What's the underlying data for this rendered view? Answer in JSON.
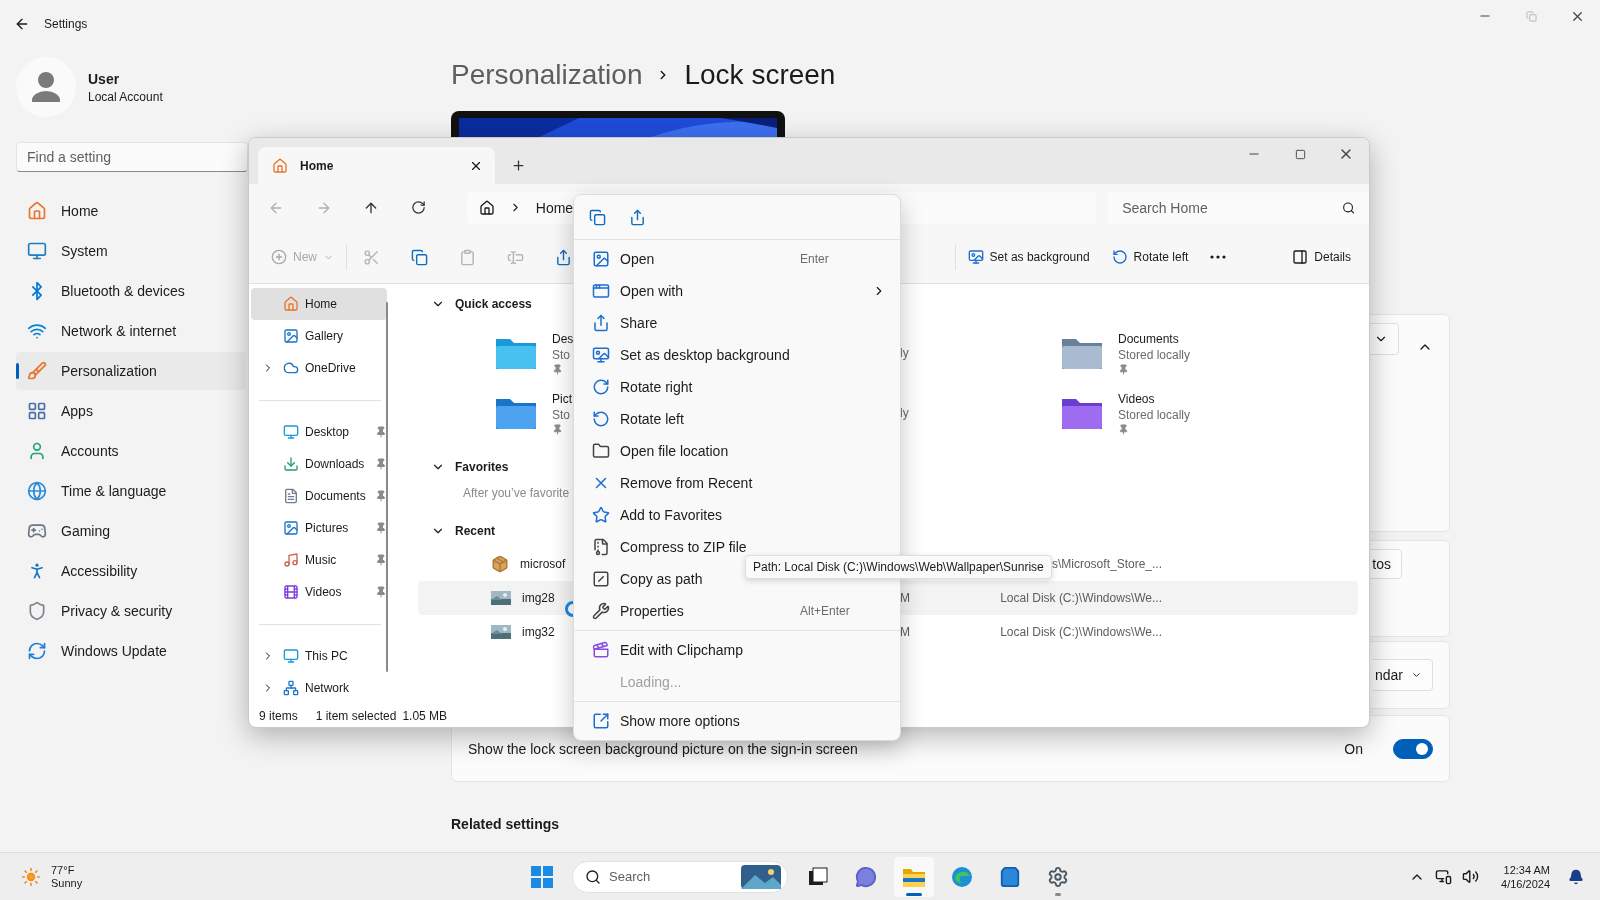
{
  "settings": {
    "title": "Settings",
    "user": {
      "name": "User",
      "account": "Local Account"
    },
    "search": {
      "placeholder": "Find a setting"
    },
    "nav": [
      {
        "label": "Home",
        "selected": false
      },
      {
        "label": "System",
        "selected": false
      },
      {
        "label": "Bluetooth & devices",
        "selected": false
      },
      {
        "label": "Network & internet",
        "selected": false
      },
      {
        "label": "Personalization",
        "selected": true
      },
      {
        "label": "Apps",
        "selected": false
      },
      {
        "label": "Accounts",
        "selected": false
      },
      {
        "label": "Time & language",
        "selected": false
      },
      {
        "label": "Gaming",
        "selected": false
      },
      {
        "label": "Accessibility",
        "selected": false
      },
      {
        "label": "Privacy & security",
        "selected": false
      },
      {
        "label": "Windows Update",
        "selected": false
      }
    ],
    "breadcrumb": {
      "parent": "Personalization",
      "current": "Lock screen"
    },
    "expand_card": {
      "expanded": true
    },
    "card_button": {
      "label": "tos"
    },
    "dropdown": {
      "value": "ndar"
    },
    "sign_in_setting": {
      "label": "Show the lock screen background picture on the sign-in screen",
      "state_text": "On",
      "on": true
    },
    "related_settings": {
      "title": "Related settings"
    }
  },
  "explorer": {
    "tab": {
      "title": "Home"
    },
    "address": {
      "location": "Home"
    },
    "search": {
      "placeholder": "Search Home"
    },
    "new_button": {
      "label": "New",
      "disabled": true
    },
    "command_icons": [
      {
        "disabled": true
      },
      {
        "disabled": false
      },
      {
        "disabled": true
      },
      {
        "disabled": true
      },
      {
        "disabled": false
      }
    ],
    "commands": [
      {
        "label": "Set as background"
      },
      {
        "label": "Rotate left"
      }
    ],
    "details_button": {
      "label": "Details"
    },
    "nav_groups": [
      [
        {
          "label": "Home",
          "selected": true
        },
        {
          "label": "Gallery",
          "selected": false
        },
        {
          "label": "OneDrive",
          "selected": false,
          "expanded": false
        }
      ],
      [
        {
          "label": "Desktop",
          "selected": false,
          "pinned": true
        },
        {
          "label": "Downloads",
          "selected": false,
          "pinned": true
        },
        {
          "label": "Documents",
          "selected": false,
          "pinned": true
        },
        {
          "label": "Pictures",
          "selected": false,
          "pinned": true
        },
        {
          "label": "Music",
          "selected": false,
          "pinned": true
        },
        {
          "label": "Videos",
          "selected": false,
          "pinned": true
        }
      ],
      [
        {
          "label": "This PC",
          "selected": false,
          "expanded": false
        },
        {
          "label": "Network",
          "selected": false,
          "expanded": false
        }
      ]
    ],
    "quick_access": {
      "title": "Quick access",
      "expanded": true,
      "items": [
        {
          "name": "Des",
          "detail": "Sto",
          "pinned": true
        },
        {
          "detail": "ly"
        },
        {
          "name": "Documents",
          "detail": "Stored locally",
          "pinned": true
        },
        {
          "name": "Pict",
          "detail": "Sto",
          "pinned": true
        },
        {
          "detail": "ly"
        },
        {
          "name": "Videos",
          "detail": "Stored locally",
          "pinned": true
        }
      ]
    },
    "favorites": {
      "title": "Favorites",
      "expanded": true,
      "hint": "After you’ve favorite"
    },
    "recent": {
      "title": "Recent",
      "expanded": true,
      "rows": [
        {
          "name": "microsof",
          "location": "s\\Microsoft_Store_...",
          "selected": false
        },
        {
          "name": "img28",
          "date": "M",
          "location": "Local Disk (C:)\\Windows\\We...",
          "selected": true
        },
        {
          "name": "img32",
          "date": "M",
          "location": "Local Disk (C:)\\Windows\\We...",
          "selected": false
        }
      ]
    },
    "status": {
      "count": "9 items",
      "selection": "1 item selected",
      "size": "1.05 MB"
    }
  },
  "context_menu": {
    "groups": [
      [
        {
          "label": "Open",
          "shortcut": "Enter",
          "submenu": false,
          "disabled": false
        },
        {
          "label": "Open with",
          "submenu": true,
          "disabled": false
        },
        {
          "label": "Share",
          "submenu": false,
          "disabled": false
        },
        {
          "label": "Set as desktop background",
          "submenu": false,
          "disabled": false
        },
        {
          "label": "Rotate right",
          "submenu": false,
          "disabled": false
        },
        {
          "label": "Rotate left",
          "submenu": false,
          "disabled": false
        },
        {
          "label": "Open file location",
          "submenu": false,
          "disabled": false
        },
        {
          "label": "Remove from Recent",
          "submenu": false,
          "disabled": false
        },
        {
          "label": "Add to Favorites",
          "submenu": false,
          "disabled": false
        },
        {
          "label": "Compress to ZIP file",
          "submenu": false,
          "disabled": false
        },
        {
          "label": "Copy as path",
          "submenu": false,
          "disabled": false
        },
        {
          "label": "Properties",
          "shortcut": "Alt+Enter",
          "submenu": false,
          "disabled": false
        }
      ],
      [
        {
          "label": "Edit with Clipchamp",
          "submenu": false,
          "disabled": false
        },
        {
          "label": "Loading...",
          "submenu": false,
          "disabled": true
        }
      ],
      [
        {
          "label": "Show more options",
          "submenu": false,
          "disabled": false
        }
      ]
    ]
  },
  "tooltip": {
    "text": "Path: Local Disk (C:)\\Windows\\Web\\Wallpaper\\Sunrise"
  },
  "taskbar": {
    "weather": {
      "temperature": "77°F",
      "condition": "Sunny"
    },
    "search": {
      "placeholder": "Search"
    },
    "apps": [
      {
        "active": false,
        "running": false
      },
      {
        "active": false,
        "running": false
      },
      {
        "active": true,
        "running": true
      },
      {
        "active": false,
        "running": false
      },
      {
        "active": false,
        "running": false
      },
      {
        "active": false,
        "running": true
      }
    ],
    "clock": {
      "time": "12:34 AM",
      "date": "4/16/2024"
    }
  }
}
